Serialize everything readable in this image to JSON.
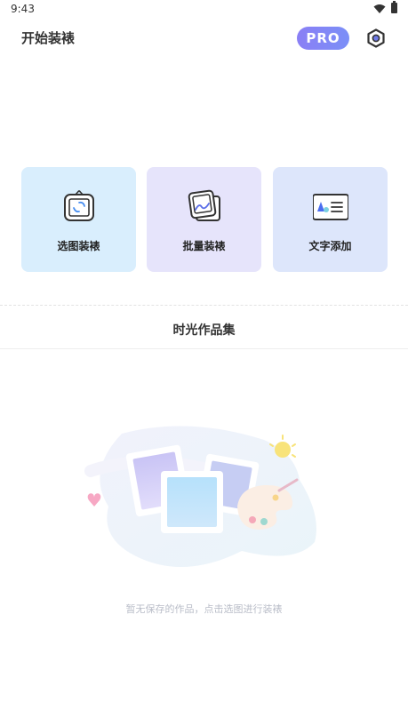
{
  "status_bar": {
    "time": "9:43",
    "wifi_icon": "wifi-icon",
    "battery_icon": "battery-icon"
  },
  "header": {
    "title": "开始装裱",
    "pro_badge": "PRO",
    "settings_icon": "settings-hexagon-icon"
  },
  "actions": [
    {
      "label": "选图装裱",
      "icon": "select-image-frame-icon",
      "bg": "#d9eefd"
    },
    {
      "label": "批量装裱",
      "icon": "batch-frame-icon",
      "bg": "#e6e4fb"
    },
    {
      "label": "文字添加",
      "icon": "add-text-card-icon",
      "bg": "#dde6fb"
    }
  ],
  "gallery": {
    "title": "时光作品集",
    "empty_message": "暂无保存的作品，点击选图进行装裱",
    "illustration": "empty-gallery-illustration"
  },
  "colors": {
    "pro_gradient_start": "#8a7ff5",
    "pro_gradient_end": "#7b8ff7",
    "empty_text": "#b9bdc8"
  }
}
